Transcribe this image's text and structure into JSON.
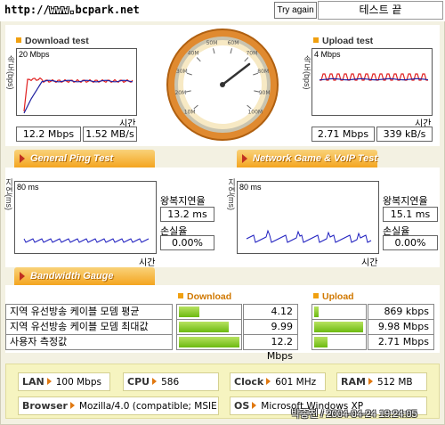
{
  "url": "http://www.bcpark.net",
  "buttons": {
    "try_again": "Try again"
  },
  "status_text": "테스트 끝",
  "download": {
    "title": "Download test",
    "axis_label": "속도(bps)",
    "scale": "20 Mbps",
    "time_label": "시간",
    "mbps": "12.2 Mbps",
    "mbs": "1.52 MB/s"
  },
  "upload": {
    "title": "Upload test",
    "axis_label": "속도(bps)",
    "scale": "4 Mbps",
    "time_label": "시간",
    "mbps": "2.71 Mbps",
    "kbs": "339 kB/s"
  },
  "gauge": {
    "ticks": [
      "10M",
      "20M",
      "30M",
      "40M",
      "50M",
      "60M",
      "70M",
      "80M",
      "90M",
      "100M"
    ]
  },
  "tabs": {
    "ping": "General Ping Test",
    "game": "Network Game & VoIP Test",
    "bandwidth": "Bandwidth Gauge"
  },
  "ping": {
    "axis_label": "지연(ms)",
    "scale": "80 ms",
    "time_label": "시간",
    "rtt_label": "왕복지연율",
    "rtt": "13.2 ms",
    "loss_label": "손실율",
    "loss": "0.00%"
  },
  "game": {
    "axis_label": "지연(ms)",
    "scale": "80 ms",
    "time_label": "시간",
    "rtt_label": "왕복지연율",
    "rtt": "15.1 ms",
    "loss_label": "손실율",
    "loss": "0.00%"
  },
  "bandwidth": {
    "download_header": "Download",
    "upload_header": "Upload",
    "rows": [
      {
        "label": "지역 유선방송 케이블 모뎀 평균",
        "down": "4.12 Mbps",
        "down_frac": 0.34,
        "up": "869 kbps",
        "up_frac": 0.09
      },
      {
        "label": "지역 유선방송 케이블 모뎀 최대값",
        "down": "9.99 Mbps",
        "down_frac": 0.82,
        "up": "9.98 Mbps",
        "up_frac": 0.98
      },
      {
        "label": "사용자 측정값",
        "down": "12.2 Mbps",
        "down_frac": 1.0,
        "up": "2.71 Mbps",
        "up_frac": 0.27
      }
    ]
  },
  "system": {
    "lan_label": "LAN",
    "lan": "100 Mbps",
    "cpu_label": "CPU",
    "cpu": "586",
    "clock_label": "Clock",
    "clock": "601 MHz",
    "ram_label": "RAM",
    "ram": "512 MB",
    "browser_label": "Browser",
    "browser": "Mozilla/4.0 (compatible; MSIE 6.0",
    "os_label": "OS",
    "os": "Microsoft Windows XP"
  },
  "stamp": "박종천 / 2004-04-24 19:24:05",
  "colors": {
    "accent": "#f4a520",
    "download_line": "#e02020",
    "upload_line": "#e02020",
    "avg_line": "#2020a0",
    "bar": "#8ccc20"
  }
}
